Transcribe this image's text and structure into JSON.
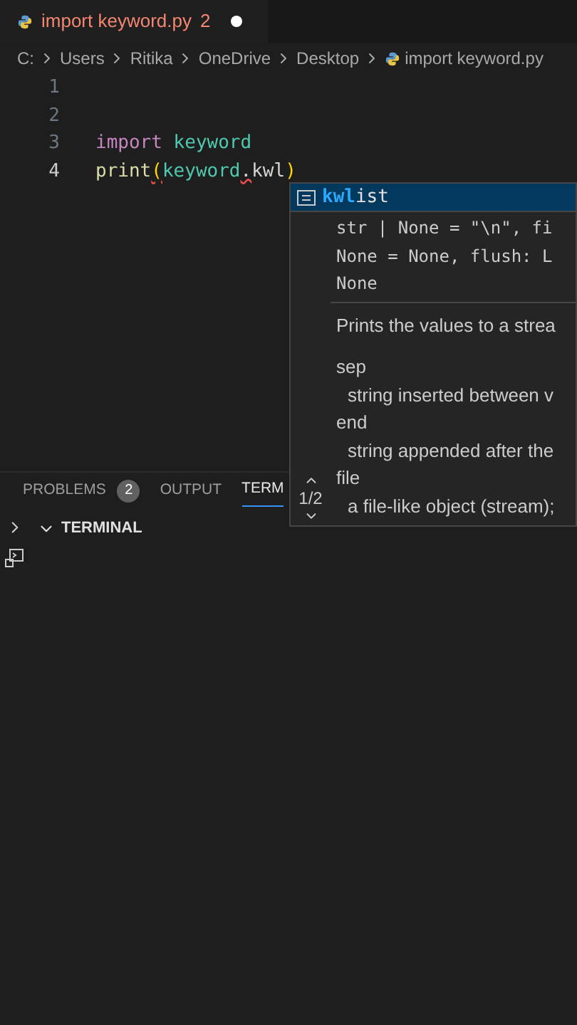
{
  "tab": {
    "title": "import keyword.py",
    "problems": "2",
    "modified": true
  },
  "breadcrumbs": [
    "C:",
    "Users",
    "Ritika",
    "OneDrive",
    "Desktop",
    "import keyword.py"
  ],
  "editor": {
    "lines": [
      {
        "number": "1",
        "current": false
      },
      {
        "number": "2",
        "current": false
      },
      {
        "number": "3",
        "current": false,
        "tokens": [
          {
            "text": "import",
            "kind": "keyword",
            "squiggle": false
          },
          {
            "text": " keyword",
            "kind": "module",
            "squiggle": false
          }
        ]
      },
      {
        "number": "4",
        "current": true,
        "tokens": [
          {
            "text": "print",
            "kind": "function",
            "squiggle": false
          },
          {
            "text": "(",
            "kind": "bracket",
            "squiggle": true
          },
          {
            "text": "keyword",
            "kind": "module",
            "squiggle": false
          },
          {
            "text": ".",
            "kind": "plain",
            "squiggle": true
          },
          {
            "text": "kwl",
            "kind": "plain",
            "squiggle": false
          },
          {
            "text": ")",
            "kind": "bracket",
            "squiggle": false
          }
        ]
      }
    ]
  },
  "suggest": {
    "match": "kwl",
    "rest": "ist",
    "selected": true,
    "signature": [
      "str | None = \"\\n\", fi",
      "None = None, flush: L",
      "None"
    ],
    "doc": [
      {
        "text": "Prints the values to a strea",
        "kind": "summary"
      },
      {
        "text": "sep",
        "kind": "param"
      },
      {
        "text": "string inserted between v",
        "kind": "desc"
      },
      {
        "text": "end",
        "kind": "param"
      },
      {
        "text": "string appended after the",
        "kind": "desc"
      },
      {
        "text": "file",
        "kind": "param"
      },
      {
        "text": "a file-like object (stream);",
        "kind": "desc"
      }
    ],
    "page": "1/2"
  },
  "panel": {
    "tabs": [
      {
        "label": "PROBLEMS",
        "badge": "2",
        "selected": false
      },
      {
        "label": "OUTPUT",
        "selected": false
      },
      {
        "label": "TERM",
        "selected": true
      }
    ],
    "section": {
      "title": "TERMINAL",
      "expanded": true
    }
  }
}
